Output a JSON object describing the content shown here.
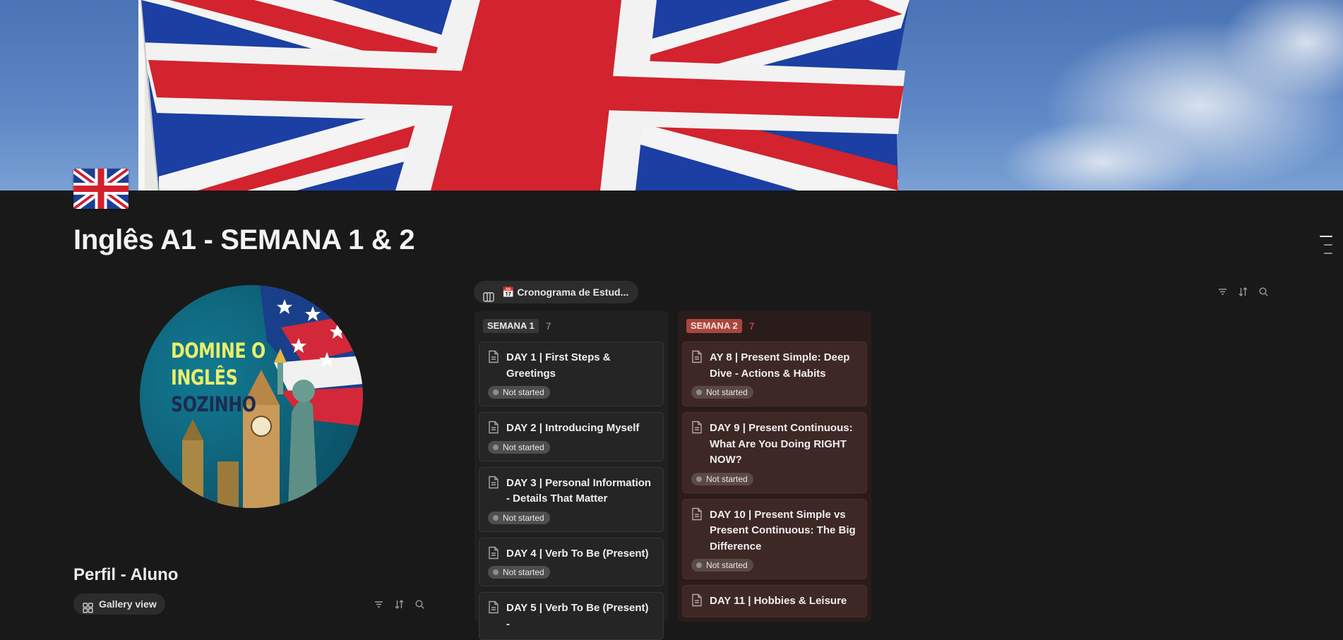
{
  "page": {
    "title": "Inglês A1 - SEMANA 1 & 2",
    "icon": "uk-flag-icon",
    "cover": "union-jack-flag-photo"
  },
  "logo": {
    "line1": "DOMINE O",
    "line2": "INGLÊS",
    "line3": "SOZINHO"
  },
  "profile": {
    "heading": "Perfil - Aluno",
    "view_label": "Gallery view",
    "view_icon": "gallery-grid-icon"
  },
  "board": {
    "view_label": "📅 Cronograma de Estud...",
    "view_icon": "board-columns-icon",
    "groups": [
      {
        "tag": "SEMANA 1",
        "count": "7",
        "color": "#373737",
        "cards": [
          {
            "title": "DAY 1 | First Steps & Greetings",
            "status": "Not started"
          },
          {
            "title": "DAY 2 | Introducing Myself",
            "status": "Not started"
          },
          {
            "title": "DAY 3 | Personal Information - Details That Matter",
            "status": "Not started"
          },
          {
            "title": "DAY 4 | Verb To Be (Present)",
            "status": "Not started"
          },
          {
            "title": "DAY 5 | Verb To Be (Present) -",
            "status": ""
          }
        ]
      },
      {
        "tag": "SEMANA 2",
        "count": "7",
        "color": "#a9463c",
        "cards": [
          {
            "title": "AY 8 | Present Simple: Deep Dive - Actions & Habits",
            "status": "Not started"
          },
          {
            "title": "DAY 9 | Present Continuous: What Are You Doing RIGHT NOW?",
            "status": "Not started"
          },
          {
            "title": "DAY 10 | Present Simple vs Present Continuous: The Big Difference",
            "status": "Not started"
          },
          {
            "title": "DAY 11 | Hobbies & Leisure",
            "status": ""
          }
        ]
      }
    ]
  },
  "toolbar_icons": [
    "filter-icon",
    "sort-icon",
    "search-icon"
  ]
}
